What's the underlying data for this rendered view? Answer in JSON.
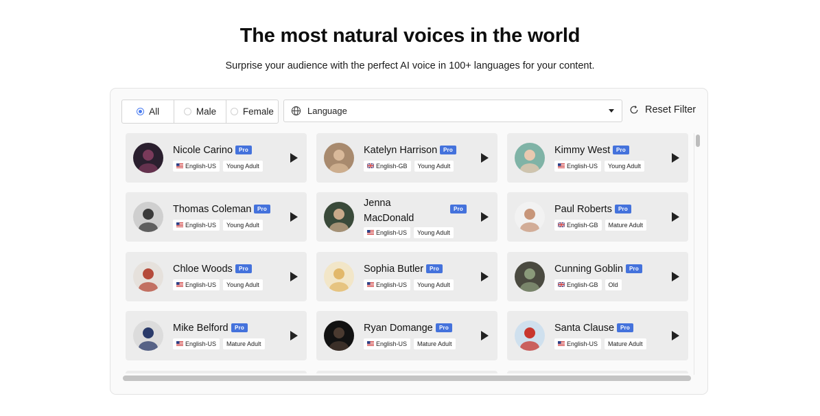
{
  "hero": {
    "title": "The most natural voices in the world",
    "subtitle": "Surprise your audience with the perfect AI voice in 100+ languages for your content."
  },
  "filters": {
    "gender": [
      {
        "label": "All",
        "selected": true
      },
      {
        "label": "Male",
        "selected": false
      },
      {
        "label": "Female",
        "selected": false
      }
    ],
    "language_placeholder": "Language",
    "reset_label": "Reset Filter"
  },
  "badge_label": "Pro",
  "voices": [
    {
      "name": "Nicole Carino",
      "lang": "English-US",
      "flag": "us",
      "age": "Young Adult",
      "avatar_bg": "#2a1f2e",
      "avatar_fg": "#7a3a5a"
    },
    {
      "name": "Katelyn Harrison",
      "lang": "English-GB",
      "flag": "gb",
      "age": "Young Adult",
      "avatar_bg": "#a88a6e",
      "avatar_fg": "#d9b99a"
    },
    {
      "name": "Kimmy West",
      "lang": "English-US",
      "flag": "us",
      "age": "Young Adult",
      "avatar_bg": "#7fb3a6",
      "avatar_fg": "#e9c9b0"
    },
    {
      "name": "Thomas Coleman",
      "lang": "English-US",
      "flag": "us",
      "age": "Young Adult",
      "avatar_bg": "#cfcfcf",
      "avatar_fg": "#3a3a3a"
    },
    {
      "name": "Jenna MacDonald",
      "lang": "English-US",
      "flag": "us",
      "age": "Young Adult",
      "avatar_bg": "#3a4a3a",
      "avatar_fg": "#c9a98a"
    },
    {
      "name": "Paul Roberts",
      "lang": "English-GB",
      "flag": "gb",
      "age": "Mature Adult",
      "avatar_bg": "#f2f2f2",
      "avatar_fg": "#c7967a"
    },
    {
      "name": "Chloe Woods",
      "lang": "English-US",
      "flag": "us",
      "age": "Young Adult",
      "avatar_bg": "#e6e1dc",
      "avatar_fg": "#b54a3a"
    },
    {
      "name": "Sophia Butler",
      "lang": "English-US",
      "flag": "us",
      "age": "Young Adult",
      "avatar_bg": "#f2e6c8",
      "avatar_fg": "#e2b86a"
    },
    {
      "name": "Cunning Goblin",
      "lang": "English-GB",
      "flag": "gb",
      "age": "Old",
      "avatar_bg": "#4a4a40",
      "avatar_fg": "#8a9a7a"
    },
    {
      "name": "Mike Belford",
      "lang": "English-US",
      "flag": "us",
      "age": "Mature Adult",
      "avatar_bg": "#dcdcdc",
      "avatar_fg": "#2a3a6a"
    },
    {
      "name": "Ryan Domange",
      "lang": "English-US",
      "flag": "us",
      "age": "Mature Adult",
      "avatar_bg": "#121212",
      "avatar_fg": "#4a3a30"
    },
    {
      "name": "Santa Clause",
      "lang": "English-US",
      "flag": "us",
      "age": "Mature Adult",
      "avatar_bg": "#cfe0ee",
      "avatar_fg": "#c8362e"
    }
  ],
  "icons": {
    "language": "globe-icon",
    "reset": "refresh-icon",
    "play": "play-icon"
  },
  "colors": {
    "accent": "#4a7cf0",
    "badge": "#4472dc",
    "card": "#ececec"
  }
}
